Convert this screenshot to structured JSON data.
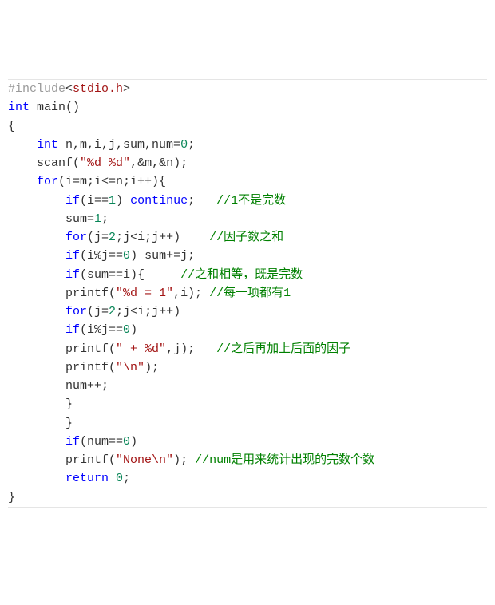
{
  "code": {
    "lines": [
      {
        "i": 0,
        "seg": [
          {
            "c": "pp",
            "t": "#include"
          },
          {
            "c": "pun",
            "t": "<"
          },
          {
            "c": "inc",
            "t": "stdio.h"
          },
          {
            "c": "pun",
            "t": ">"
          }
        ]
      },
      {
        "i": 0,
        "seg": [
          {
            "c": "typ",
            "t": "int"
          },
          {
            "c": "pun",
            "t": " main()"
          }
        ]
      },
      {
        "i": 0,
        "seg": [
          {
            "c": "pun",
            "t": "{"
          }
        ]
      },
      {
        "i": 1,
        "seg": [
          {
            "c": "typ",
            "t": "int"
          },
          {
            "c": "pun",
            "t": " n,m,i,j,sum,num="
          },
          {
            "c": "num",
            "t": "0"
          },
          {
            "c": "pun",
            "t": ";"
          }
        ]
      },
      {
        "i": 1,
        "seg": [
          {
            "c": "fn",
            "t": "scanf"
          },
          {
            "c": "pun",
            "t": "("
          },
          {
            "c": "str",
            "t": "\"%d %d\""
          },
          {
            "c": "pun",
            "t": ",&m,&n);"
          }
        ]
      },
      {
        "i": 1,
        "seg": [
          {
            "c": "kw",
            "t": "for"
          },
          {
            "c": "pun",
            "t": "(i=m;i<=n;i++){"
          }
        ]
      },
      {
        "i": 2,
        "seg": [
          {
            "c": "kw",
            "t": "if"
          },
          {
            "c": "pun",
            "t": "(i=="
          },
          {
            "c": "num",
            "t": "1"
          },
          {
            "c": "pun",
            "t": ") "
          },
          {
            "c": "kw",
            "t": "continue"
          },
          {
            "c": "pun",
            "t": ";   "
          },
          {
            "c": "cmt",
            "t": "//1不是完数"
          }
        ]
      },
      {
        "i": 2,
        "seg": [
          {
            "c": "pun",
            "t": "sum="
          },
          {
            "c": "num",
            "t": "1"
          },
          {
            "c": "pun",
            "t": ";"
          }
        ]
      },
      {
        "i": 2,
        "seg": [
          {
            "c": "kw",
            "t": "for"
          },
          {
            "c": "pun",
            "t": "(j="
          },
          {
            "c": "num",
            "t": "2"
          },
          {
            "c": "pun",
            "t": ";j<i;j++)    "
          },
          {
            "c": "cmt",
            "t": "//因子数之和"
          }
        ]
      },
      {
        "i": 2,
        "seg": [
          {
            "c": "kw",
            "t": "if"
          },
          {
            "c": "pun",
            "t": "(i%j=="
          },
          {
            "c": "num",
            "t": "0"
          },
          {
            "c": "pun",
            "t": ") sum+=j;"
          }
        ]
      },
      {
        "i": 2,
        "seg": [
          {
            "c": "kw",
            "t": "if"
          },
          {
            "c": "pun",
            "t": "(sum==i){     "
          },
          {
            "c": "cmt",
            "t": "//之和相等，既是完数"
          }
        ]
      },
      {
        "i": 2,
        "seg": [
          {
            "c": "fn",
            "t": "printf"
          },
          {
            "c": "pun",
            "t": "("
          },
          {
            "c": "str",
            "t": "\"%d = 1\""
          },
          {
            "c": "pun",
            "t": ",i); "
          },
          {
            "c": "cmt",
            "t": "//每一项都有1"
          }
        ]
      },
      {
        "i": 2,
        "seg": [
          {
            "c": "kw",
            "t": "for"
          },
          {
            "c": "pun",
            "t": "(j="
          },
          {
            "c": "num",
            "t": "2"
          },
          {
            "c": "pun",
            "t": ";j<i;j++)"
          }
        ]
      },
      {
        "i": 2,
        "seg": [
          {
            "c": "kw",
            "t": "if"
          },
          {
            "c": "pun",
            "t": "(i%j=="
          },
          {
            "c": "num",
            "t": "0"
          },
          {
            "c": "pun",
            "t": ")"
          }
        ]
      },
      {
        "i": 2,
        "seg": [
          {
            "c": "fn",
            "t": "printf"
          },
          {
            "c": "pun",
            "t": "("
          },
          {
            "c": "str",
            "t": "\" + %d\""
          },
          {
            "c": "pun",
            "t": ",j);   "
          },
          {
            "c": "cmt",
            "t": "//之后再加上后面的因子"
          }
        ]
      },
      {
        "i": 2,
        "seg": [
          {
            "c": "fn",
            "t": "printf"
          },
          {
            "c": "pun",
            "t": "("
          },
          {
            "c": "str",
            "t": "\"\\n\""
          },
          {
            "c": "pun",
            "t": ");"
          }
        ]
      },
      {
        "i": 2,
        "seg": [
          {
            "c": "pun",
            "t": "num++;"
          }
        ]
      },
      {
        "i": 2,
        "seg": [
          {
            "c": "pun",
            "t": "}"
          }
        ]
      },
      {
        "i": 2,
        "seg": [
          {
            "c": "pun",
            "t": "}"
          }
        ]
      },
      {
        "i": 2,
        "seg": [
          {
            "c": "kw",
            "t": "if"
          },
          {
            "c": "pun",
            "t": "(num=="
          },
          {
            "c": "num",
            "t": "0"
          },
          {
            "c": "pun",
            "t": ")"
          }
        ]
      },
      {
        "i": 2,
        "seg": [
          {
            "c": "fn",
            "t": "printf"
          },
          {
            "c": "pun",
            "t": "("
          },
          {
            "c": "str",
            "t": "\"None\\n\""
          },
          {
            "c": "pun",
            "t": "); "
          },
          {
            "c": "cmt",
            "t": "//num是用来统计出现的完数个数"
          }
        ]
      },
      {
        "i": 2,
        "seg": [
          {
            "c": "kw",
            "t": "return"
          },
          {
            "c": "pun",
            "t": " "
          },
          {
            "c": "num",
            "t": "0"
          },
          {
            "c": "pun",
            "t": ";"
          }
        ]
      },
      {
        "i": 0,
        "seg": [
          {
            "c": "pun",
            "t": "}"
          }
        ]
      }
    ],
    "indent_unit": "    "
  }
}
